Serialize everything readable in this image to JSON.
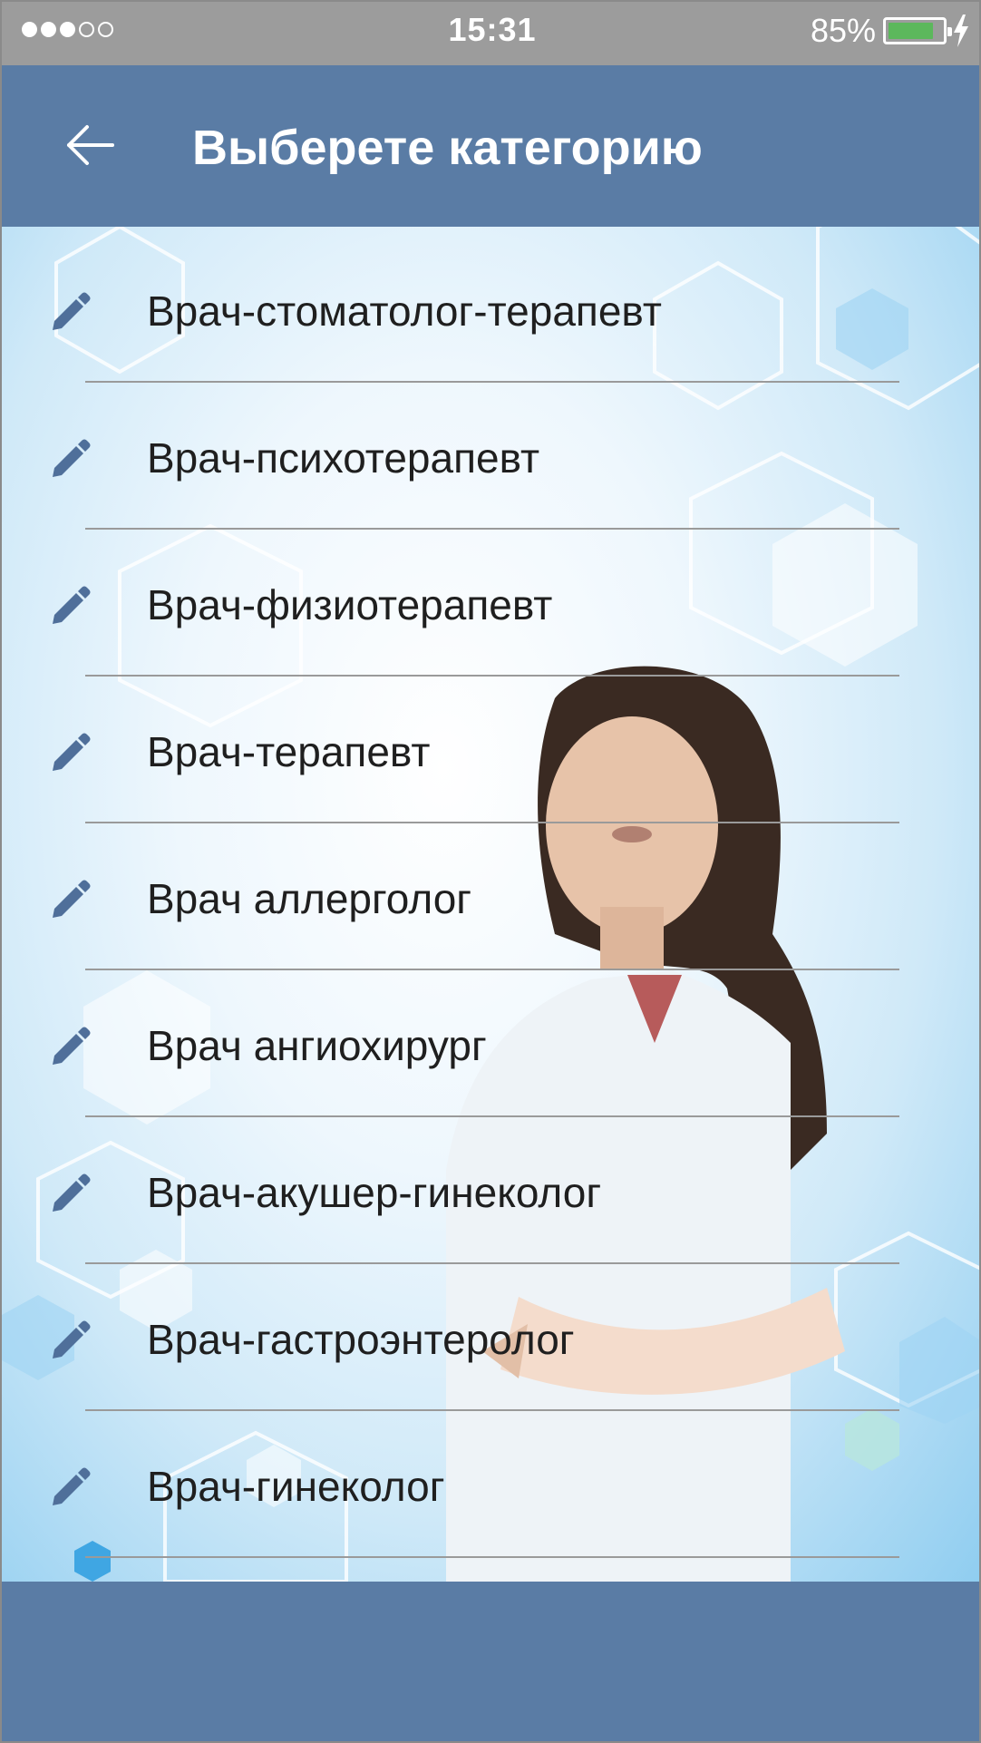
{
  "status_bar": {
    "signal_filled": 3,
    "signal_total": 5,
    "time": "15:31",
    "battery_percent": "85%",
    "battery_level": 0.85,
    "battery_color": "#5cb85c"
  },
  "header": {
    "title": "Выберете категорию",
    "back_icon": "arrow-left-icon",
    "background": "#5a7ca5"
  },
  "categories": [
    {
      "label": "Врач-стоматолог-терапевт",
      "icon": "pencil-icon"
    },
    {
      "label": "Врач-психотерапевт",
      "icon": "pencil-icon"
    },
    {
      "label": "Врач-физиотерапевт",
      "icon": "pencil-icon"
    },
    {
      "label": "Врач-терапевт",
      "icon": "pencil-icon"
    },
    {
      "label": "Врач аллерголог",
      "icon": "pencil-icon"
    },
    {
      "label": "Врач ангиохирург",
      "icon": "pencil-icon"
    },
    {
      "label": "Врач-акушер-гинеколог",
      "icon": "pencil-icon"
    },
    {
      "label": "Врач-гастроэнтеролог",
      "icon": "pencil-icon"
    },
    {
      "label": "Врач-гинеколог",
      "icon": "pencil-icon"
    }
  ],
  "colors": {
    "accent": "#5a7ca5",
    "pencil": "#4f6f9a",
    "divider": "#9a9a9a",
    "text": "#1f1f1f"
  }
}
